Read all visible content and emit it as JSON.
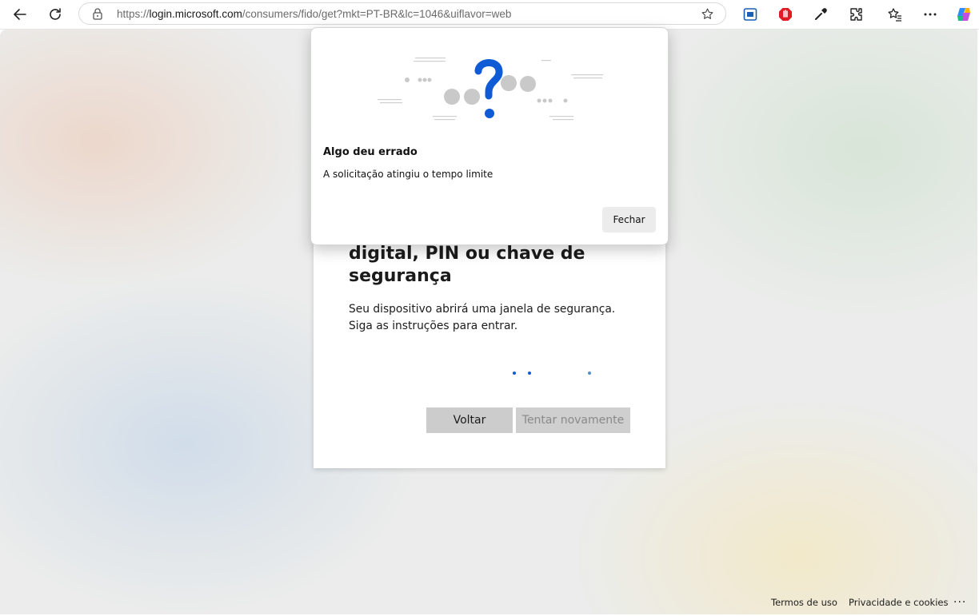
{
  "browser": {
    "url_prefix": "https://",
    "url_host": "login.microsoft.com",
    "url_path": "/consumers/fido/get?mkt=PT-BR&lc=1046&uiflavor=web",
    "icons": [
      "back-icon",
      "refresh-icon",
      "lock-icon",
      "favorite-star-icon",
      "screen-capture-icon",
      "adblock-icon",
      "color-picker-icon",
      "extensions-icon",
      "favorites-icon",
      "more-icon",
      "copilot-icon"
    ]
  },
  "card": {
    "heading_line1": "digital, PIN ou chave de",
    "heading_line2": "segurança",
    "description": "Seu dispositivo abrirá uma janela de segurança. Siga as instruções para entrar.",
    "back_label": "Voltar",
    "retry_label": "Tentar novamente"
  },
  "dialog": {
    "title": "Algo deu errado",
    "message": "A solicitação atingiu o tempo limite",
    "close_label": "Fechar",
    "illustration": "question-mark-illustration"
  },
  "footer": {
    "terms": "Termos de uso",
    "privacy": "Privacidade e cookies",
    "more": "..."
  },
  "colors": {
    "accent_blue": "#0f5bd6",
    "button_gray": "#cccccc"
  }
}
